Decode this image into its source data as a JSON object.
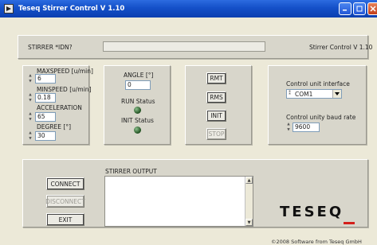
{
  "window": {
    "title": "Teseq Stirrer Control V 1.10"
  },
  "idn": {
    "label": "STIRRER *IDN?",
    "value": "",
    "version": "Stirrer Control V 1.10"
  },
  "params": {
    "maxspeed_label": "MAXSPEED [u/min]",
    "maxspeed_value": "6",
    "minspeed_label": "MINSPEED [u/min]",
    "minspeed_value": "0.18",
    "acceleration_label": "ACCELERATION",
    "acceleration_value": "65",
    "degree_label": "DEGREE [°]",
    "degree_value": "30"
  },
  "status": {
    "angle_label": "ANGLE [°]",
    "angle_value": "0",
    "run_label": "RUN Status",
    "init_label": "INIT Status"
  },
  "commands": {
    "rmt": "RMT",
    "rms": "RMS",
    "init": "INIT",
    "stop": "STOP"
  },
  "interface": {
    "control_label": "Control unit interface",
    "com_value": "COM1",
    "baud_label": "Control unity baud rate",
    "baud_value": "9600"
  },
  "connection": {
    "connect": "CONNECT",
    "disconnect": "DISCONNECT",
    "exit": "EXIT"
  },
  "output": {
    "label": "STIRRER OUTPUT",
    "text": ""
  },
  "branding": {
    "logo": "TESEQ",
    "footer": "©2008 Software from Teseq GmbH"
  },
  "colors": {
    "titlebar": "#1450c8",
    "logo_accent": "#d4201a",
    "led": "#2a5a2a"
  }
}
